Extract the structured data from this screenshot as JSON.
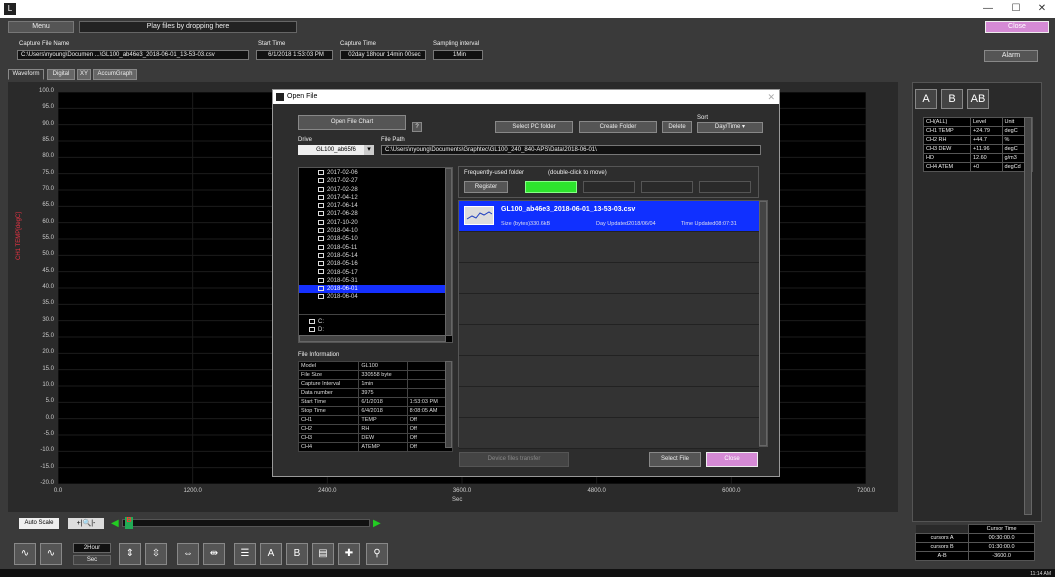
{
  "titlebar": {
    "icon": "app-logo-icon",
    "minimize": "—",
    "maximize": "☐",
    "close": "✕"
  },
  "top": {
    "menu_label": "Menu",
    "hint": "Play files by dropping here",
    "close_label": "Close",
    "alarm_label": "Alarm",
    "capture_file_name_label": "Capture File Name",
    "capture_file_name": "C:\\Users\\nyoung\\Documen ...\\GL100_ab46e3_2018-06-01_13-53-03.csv",
    "start_time_label": "Start Time",
    "start_time": "6/1/2018 1:53:03 PM",
    "capture_time_label": "Capture Time",
    "capture_time": "02day 18hour 14min 00sec",
    "sampling_label": "Sampling interval",
    "sampling": "1Min"
  },
  "tabs": [
    "Waveform",
    "Digital",
    "XY",
    "AccumGraph"
  ],
  "chart_data": {
    "type": "line",
    "title": "",
    "xlabel": "Sec",
    "ylabel": "CH1 TEMP[degC]",
    "xlim": [
      0,
      7200
    ],
    "ylim": [
      -20,
      100
    ],
    "x_ticks": [
      "0.0",
      "1200.0",
      "2400.0",
      "3600.0",
      "4800.0",
      "6000.0",
      "7200.0"
    ],
    "y_ticks": [
      "100.0",
      "95.0",
      "90.0",
      "85.0",
      "80.0",
      "75.0",
      "70.0",
      "65.0",
      "60.0",
      "55.0",
      "50.0",
      "45.0",
      "40.0",
      "35.0",
      "30.0",
      "25.0",
      "20.0",
      "15.0",
      "10.0",
      "5.0",
      "0.0",
      "-5.0",
      "-10.0",
      "-15.0",
      "-20.0"
    ],
    "series": [],
    "grid": true
  },
  "right": {
    "table_headers": [
      "CH(ALL)",
      "Level",
      "Unit"
    ],
    "channels": [
      [
        "CH1  TEMP",
        "+24.79",
        "degC"
      ],
      [
        "CH2  RH",
        "+44.7",
        "%"
      ],
      [
        "CH3  DEW",
        "+11.96",
        "degC"
      ],
      [
        "HD",
        "12.60",
        "g/m3"
      ],
      [
        "CH4  ATEM",
        "+0",
        "degCd"
      ]
    ],
    "cursor_header": "Cursor Time",
    "cursors": [
      [
        "cursors A",
        "00:30:00.0"
      ],
      [
        "cursors B",
        "01:30:00.0"
      ],
      [
        "A-B",
        "-3600.0"
      ]
    ]
  },
  "bottom": {
    "autoscale": "Auto Scale",
    "zoom": "+|🔍|-",
    "span_value": "2Hour",
    "span_unit": "Sec",
    "scroll_marker": "B"
  },
  "dialog": {
    "title": "Open File",
    "open_chart": "Open File Chart",
    "help": "?",
    "select_pc_folder": "Select PC folder",
    "create_folder": "Create Folder",
    "delete": "Delete",
    "sort_label": "Sort",
    "sort_value": "Day/Time",
    "drive_label": "Drive",
    "drive_value": "GL100_ab65f6",
    "path_label": "File Path",
    "path_value": "C:\\Users\\nyoung\\Documents\\Graphtec\\GL100_240_840-APS\\Data\\2018-06-01\\",
    "freq_label": "Frequently-used folder",
    "freq_hint": "(double-click to move)",
    "register": "Register",
    "folders": [
      "2017-02-06",
      "2017-02-27",
      "2017-02-28",
      "2017-04-12",
      "2017-06-14",
      "2017-06-28",
      "2017-10-20",
      "2018-04-10",
      "2018-05-10",
      "2018-05-11",
      "2018-05-14",
      "2018-05-16",
      "2018-05-17",
      "2018-05-31",
      "2018-06-01",
      "2018-06-04"
    ],
    "selected_folder_index": 14,
    "drives": [
      "C:",
      "D:"
    ],
    "file_info_label": "File Information",
    "file_info": [
      [
        "Model",
        "GL100",
        ""
      ],
      [
        "File Size",
        "330558 byte",
        ""
      ],
      [
        "Capture Interval",
        "1min",
        ""
      ],
      [
        "Data number",
        "3975",
        ""
      ],
      [
        "Start Time",
        "6/1/2018",
        "1:53:03 PM"
      ],
      [
        "Stop Time",
        "6/4/2018",
        "8:08:05 AM"
      ],
      [
        "CH1",
        "TEMP",
        "Off"
      ],
      [
        "CH2",
        "RH",
        "Off"
      ],
      [
        "CH3",
        "DEW",
        "Off"
      ],
      [
        "CH4",
        "ATEMP",
        "Off"
      ]
    ],
    "file": {
      "name": "GL100_ab46e3_2018-06-01_13-53-03.csv",
      "size": "Size (bytes)330.6kB",
      "day": "Day Updated2018/06/04",
      "time": "Time Updated08:07:31"
    },
    "device_transfer": "Device files transfer",
    "select_file": "Select File",
    "close": "Close"
  },
  "clock": "11:14 AM"
}
